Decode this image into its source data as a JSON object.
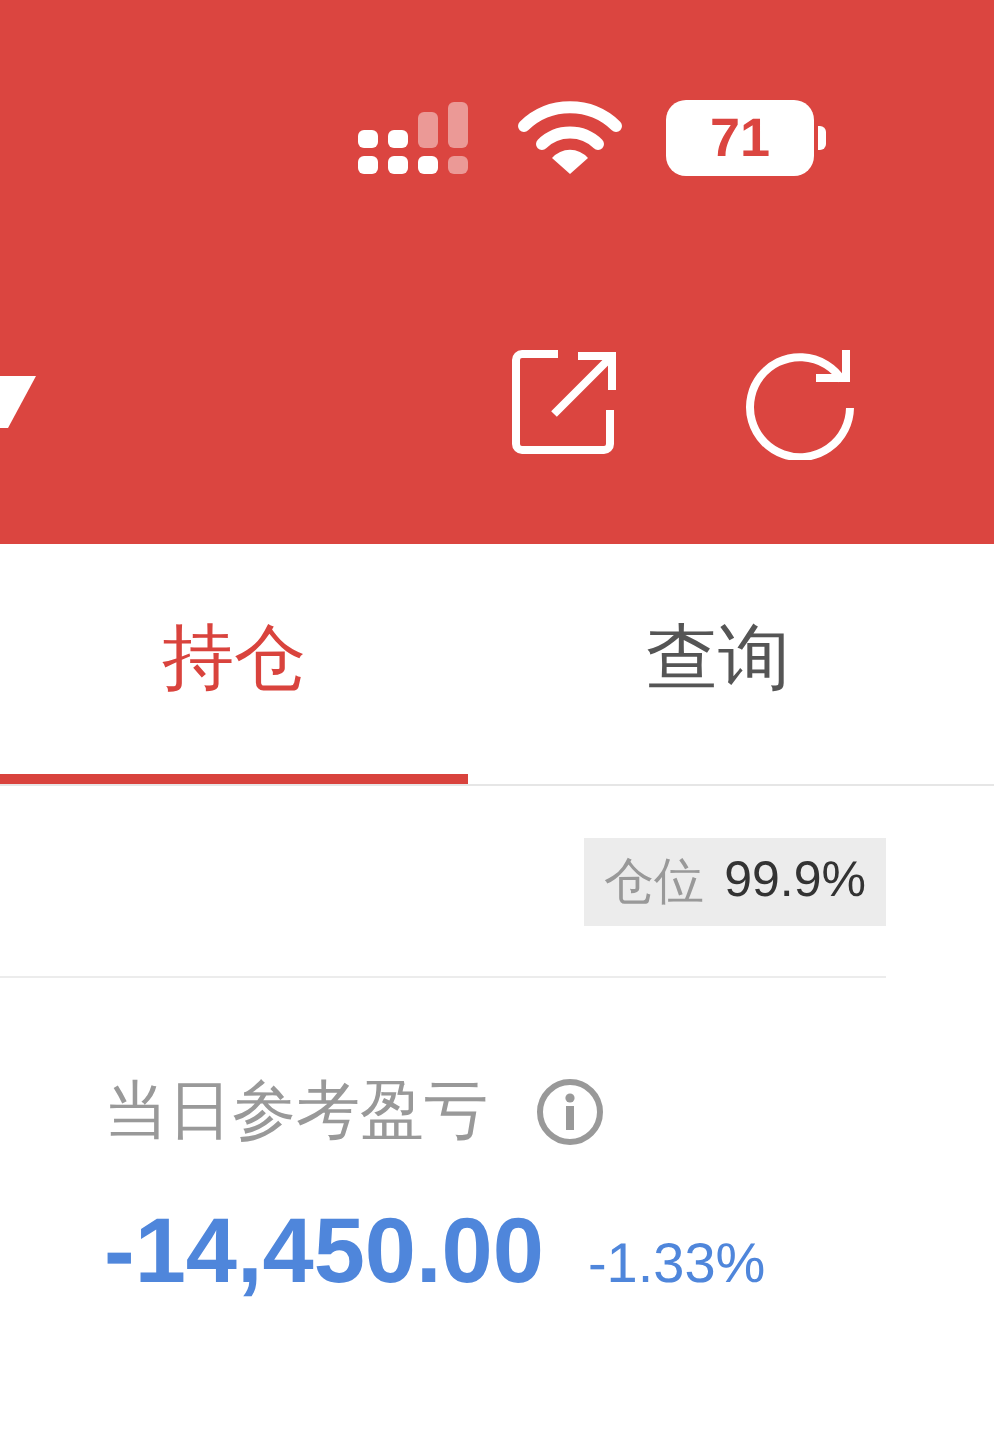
{
  "status_bar": {
    "battery": "71"
  },
  "tabs": [
    {
      "label": "持仓",
      "selected": true
    },
    {
      "label": "查询",
      "selected": false
    }
  ],
  "position": {
    "label": "仓位",
    "value": "99.9%"
  },
  "daily_pnl": {
    "label": "当日参考盈亏",
    "value": "-14,450.00",
    "percent": "-1.33%"
  }
}
